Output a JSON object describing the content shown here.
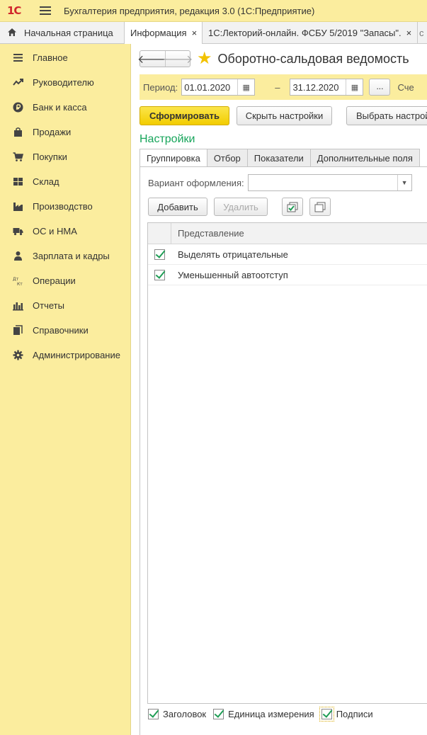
{
  "titlebar": {
    "logo": "1С",
    "title": "Бухгалтерия предприятия, редакция 3.0  (1С:Предприятие)"
  },
  "tabs": {
    "home": "Начальная страница",
    "info": "Информация",
    "lectory": "1С:Лекторий-онлайн. ФСБУ 5/2019 \"Запасы\".",
    "close_glyph": "×",
    "more": "с"
  },
  "sidebar": {
    "items": [
      {
        "label": "Главное",
        "icon": "list-icon"
      },
      {
        "label": "Руководителю",
        "icon": "trend-icon"
      },
      {
        "label": "Банк и касса",
        "icon": "ruble-icon"
      },
      {
        "label": "Продажи",
        "icon": "bag-icon"
      },
      {
        "label": "Покупки",
        "icon": "cart-icon"
      },
      {
        "label": "Склад",
        "icon": "warehouse-icon"
      },
      {
        "label": "Производство",
        "icon": "factory-icon"
      },
      {
        "label": "ОС и НМА",
        "icon": "truck-icon"
      },
      {
        "label": "Зарплата и кадры",
        "icon": "person-icon"
      },
      {
        "label": "Операции",
        "icon": "dt-kt-icon"
      },
      {
        "label": "Отчеты",
        "icon": "bar-chart-icon"
      },
      {
        "label": "Справочники",
        "icon": "books-icon"
      },
      {
        "label": "Администрирование",
        "icon": "gear-icon"
      }
    ]
  },
  "form": {
    "back": "🡐",
    "forward": "🡒",
    "title": "Оборотно-сальдовая ведомость",
    "period_label": "Период:",
    "date_from": "01.01.2020",
    "date_to": "31.12.2020",
    "dash": "–",
    "ellipsis": "...",
    "schet_label": "Сче",
    "generate": "Сформировать",
    "hide_settings": "Скрыть настройки",
    "choose_settings": "Выбрать настройки"
  },
  "settings": {
    "title": "Настройки",
    "tabs": [
      "Группировка",
      "Отбор",
      "Показатели",
      "Дополнительные поля"
    ],
    "variant_label": "Вариант оформления:",
    "variant_value": "",
    "add": "Добавить",
    "delete": "Удалить",
    "column_header": "Представление",
    "rows": [
      {
        "label": "Выделять отрицательные",
        "checked": true
      },
      {
        "label": "Уменьшенный автоотступ",
        "checked": true
      }
    ],
    "bottom": {
      "header": "Заголовок",
      "unit": "Единица измерения",
      "signatures": "Подписи"
    }
  },
  "colors": {
    "accent_yellow": "#fbed9e",
    "primary_button": "#f2cc00",
    "settings_green": "#17a55b",
    "logo_red": "#d0272c"
  }
}
